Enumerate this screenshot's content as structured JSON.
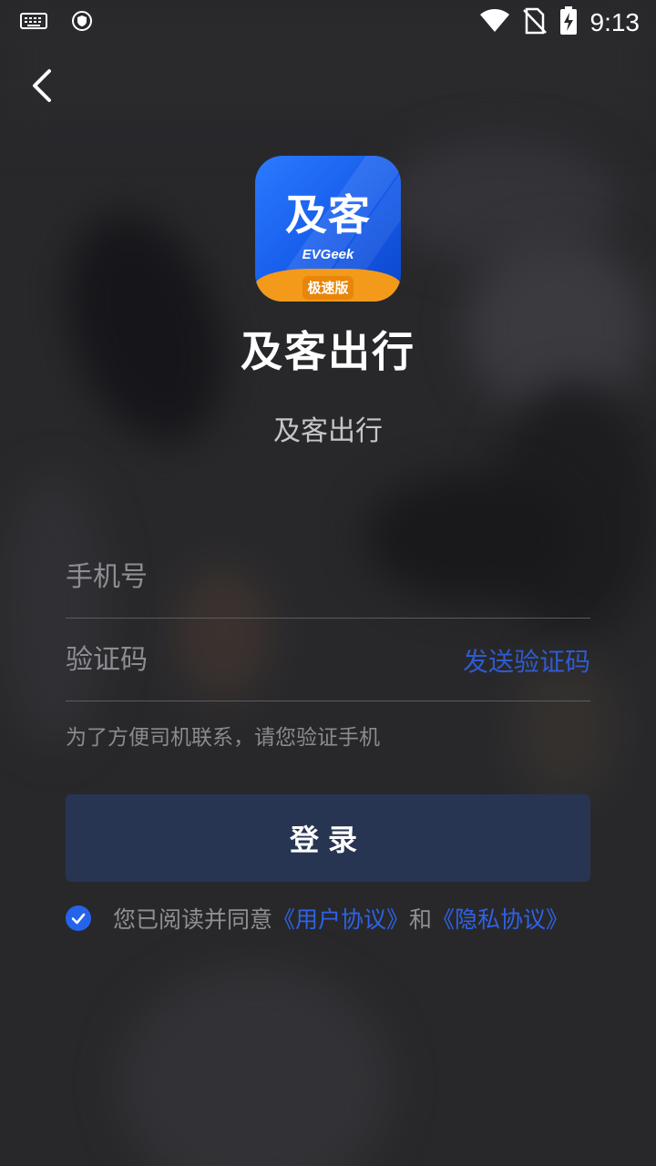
{
  "status_bar": {
    "time": "9:13",
    "icons": [
      "keyboard-icon",
      "shield-icon",
      "wifi-icon",
      "no-sim-icon",
      "battery-charging-icon"
    ]
  },
  "nav": {
    "back_icon": "chevron-left-icon"
  },
  "logo": {
    "title": "及客",
    "subtitle": "EVGeek",
    "band_label": "极速版",
    "colors": {
      "primary": "#1458e8",
      "accent": "#f39a1b"
    }
  },
  "app": {
    "name": "及客出行",
    "subtitle": "及客出行"
  },
  "form": {
    "phone_placeholder": "手机号",
    "code_placeholder": "验证码",
    "send_code_label": "发送验证码",
    "hint": "为了方便司机联系，请您验证手机",
    "login_label": "登录"
  },
  "agreement": {
    "checked": true,
    "prefix": "您已阅读并同意",
    "user_agreement": "《用户协议》",
    "conjunction": "和",
    "privacy_agreement": "《隐私协议》"
  }
}
